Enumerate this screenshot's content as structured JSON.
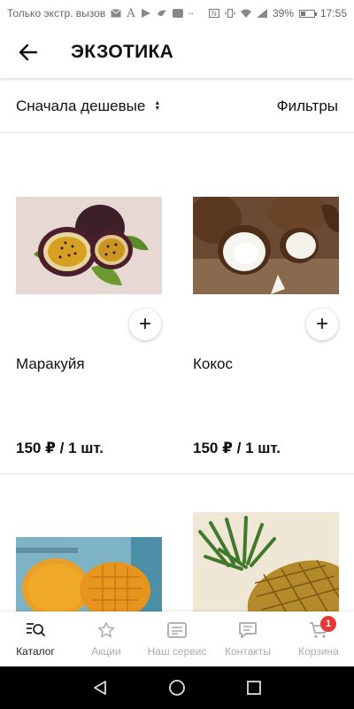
{
  "status_bar": {
    "carrier_text": "Только экстр. вызов",
    "battery_percent": "39%",
    "battery_level": 0.39,
    "time": "17:55"
  },
  "header": {
    "title": "ЭКЗОТИКА"
  },
  "toolbar": {
    "sort_label": "Сначала дешевые",
    "filters_label": "Фильтры"
  },
  "products": [
    {
      "name": "Маракуйя",
      "price": "150 ₽ / 1 шт.",
      "add_label": "+"
    },
    {
      "name": "Кокос",
      "price": "150 ₽ / 1 шт.",
      "add_label": "+"
    },
    {
      "name": "",
      "price": ""
    },
    {
      "name": "",
      "price": ""
    }
  ],
  "bottom_nav": {
    "items": [
      {
        "label": "Каталог",
        "icon": "catalog-search-icon",
        "active": true
      },
      {
        "label": "Акции",
        "icon": "star-icon"
      },
      {
        "label": "Наш сервис",
        "icon": "service-icon"
      },
      {
        "label": "Контакты",
        "icon": "chat-icon"
      },
      {
        "label": "Корзина",
        "icon": "cart-icon",
        "badge": "1"
      }
    ]
  },
  "colors": {
    "accent": "#222222",
    "inactive": "#aaaaaa",
    "badge": "#e53935"
  }
}
